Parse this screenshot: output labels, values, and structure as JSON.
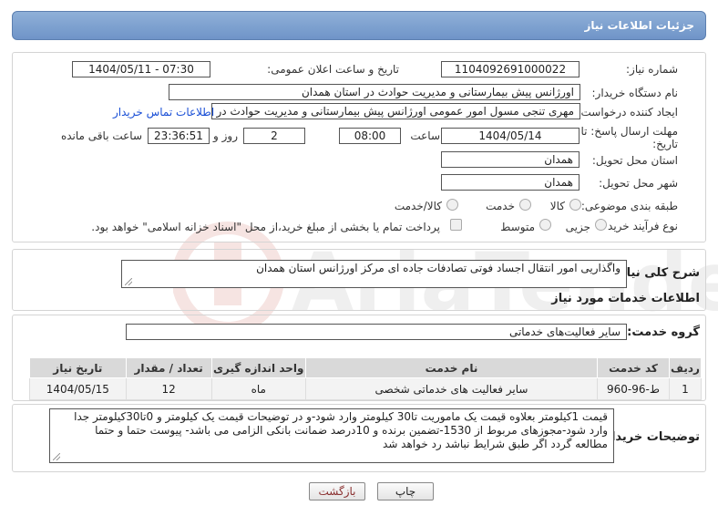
{
  "header": {
    "title": "جزئیات اطلاعات نیاز"
  },
  "fields": {
    "need_number_label": "شماره نیاز:",
    "need_number": "1104092691000022",
    "announce_label": "تاریخ و ساعت اعلان عمومی:",
    "announce_value": "1404/05/11 - 07:30",
    "buyer_label": "نام دستگاه خریدار:",
    "buyer_value": "اورژانس پیش بیمارستانی و مدیریت حوادث در استان  همدان",
    "creator_label": "ایجاد کننده درخواست:",
    "creator_value": "مهری تنجی مسول امور عمومی اورژانس پیش بیمارستانی و مدیریت حوادث در ا",
    "contact_link": "اطلاعات تماس خریدار",
    "deadline_label": "مهلت ارسال پاسخ: تا تاریخ:",
    "deadline_date": "1404/05/14",
    "time_label": "ساعت",
    "deadline_time": "08:00",
    "days_value": "2",
    "day_and_label": "روز و",
    "remaining_time": "23:36:51",
    "remaining_label": "ساعت باقی مانده",
    "province_label": "استان محل تحویل:",
    "province_value": "همدان",
    "city_label": "شهر محل تحویل:",
    "city_value": "همدان",
    "category_label": "طبقه بندی موضوعی:",
    "category_options": [
      "کالا",
      "خدمت",
      "کالا/خدمت"
    ],
    "process_label": "نوع فرآیند خرید :",
    "process_options": [
      "جزیی",
      "متوسط"
    ],
    "payment_note": "پرداخت تمام یا بخشی از مبلغ خرید،از محل \"اسناد خزانه اسلامی\" خواهد بود."
  },
  "description": {
    "label": "شرح کلی نیاز:",
    "value": "واگذاریی امور انتقال اجساد فوتی تصادفات جاده ای مرکز اورژانس استان همدان"
  },
  "services": {
    "section_title": "اطلاعات خدمات مورد نیاز",
    "group_label": "گروه خدمت:",
    "group_value": "سایر فعالیت‌های خدماتی",
    "columns": [
      "ردیف",
      "کد خدمت",
      "نام خدمت",
      "واحد اندازه گیری",
      "تعداد / مقدار",
      "تاریخ نیاز"
    ],
    "rows": [
      [
        "1",
        "ط-96-960",
        "سایر فعالیت های خدماتی شخصی",
        "ماه",
        "12",
        "1404/05/15"
      ]
    ]
  },
  "buyer_notes": {
    "label": "توضیحات خریدار:",
    "value": "قیمت 1کیلومتر بعلاوه قیمت یک ماموریت تا30 کیلومتر وارد شود-و در توضیحات قیمت یک کیلومتر و 0تا30کیلومتر جدا وارد شود-مجوزهای مربوط از 1530-تضمین برنده و 10درصد ضمانت بانکی الزامی می باشد- پیوست حتما و حتما مطالعه گردد اگر طبق شرایط نباشد رد خواهد شد"
  },
  "buttons": {
    "print": "چاپ",
    "back": "بازگشت"
  },
  "colors": {
    "header": "#7a9dcf",
    "link": "#1a4fd6"
  }
}
